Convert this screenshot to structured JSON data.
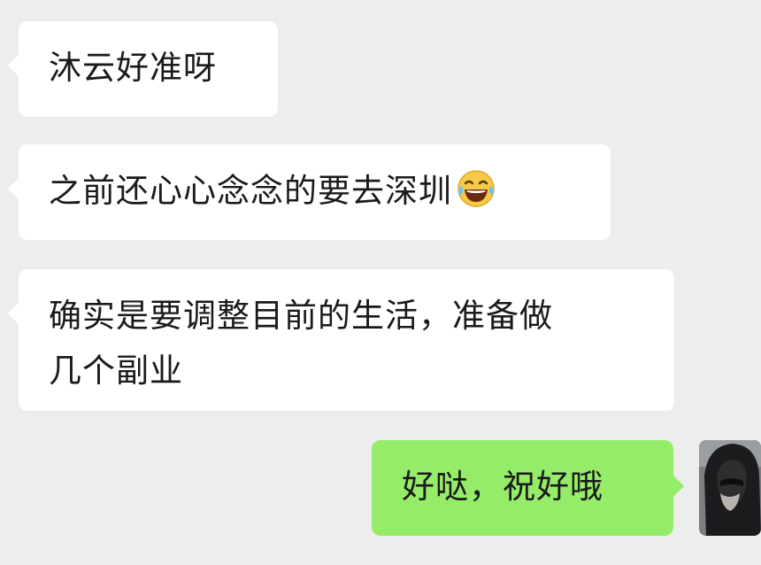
{
  "messages": [
    {
      "side": "received",
      "text": "沐云好准呀"
    },
    {
      "side": "received",
      "text": "之前还心心念念的要去深圳",
      "emoji": "laughing-tears-emoji"
    },
    {
      "side": "received",
      "lines": [
        "确实是要调整目前的生活，准备做",
        "几个副业"
      ]
    },
    {
      "side": "sent",
      "text": "好哒，祝好哦"
    }
  ],
  "colors": {
    "background": "#ededed",
    "received_bubble": "#ffffff",
    "sent_bubble": "#95ec69",
    "text": "#1a1a1a"
  },
  "avatar": {
    "icon": "user-avatar"
  }
}
